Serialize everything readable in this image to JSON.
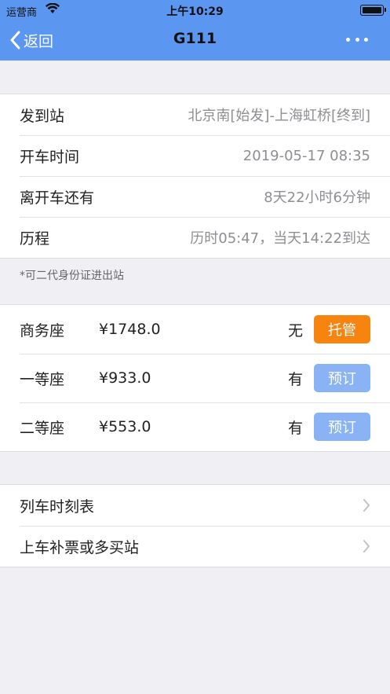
{
  "status_bar": {
    "carrier": "运营商",
    "time": "上午10:29"
  },
  "nav": {
    "back_label": "返回",
    "title": "G111"
  },
  "trip_info": [
    {
      "label": "发到站",
      "value": "北京南[始发]-上海虹桥[终到]"
    },
    {
      "label": "开车时间",
      "value": "2019-05-17 08:35"
    },
    {
      "label": "离开车还有",
      "value": "8天22小时6分钟"
    },
    {
      "label": "历程",
      "value": "历时05:47，当天14:22到达"
    }
  ],
  "note": "*可二代身份证进出站",
  "seats": [
    {
      "name": "商务座",
      "price": "¥1748.0",
      "availability": "无",
      "action": "托管",
      "action_color": "#f88410"
    },
    {
      "name": "一等座",
      "price": "¥933.0",
      "availability": "有",
      "action": "预订",
      "action_color": "#8ab3f6"
    },
    {
      "name": "二等座",
      "price": "¥553.0",
      "availability": "有",
      "action": "预订",
      "action_color": "#8ab3f6"
    }
  ],
  "links": [
    {
      "label": "列车时刻表"
    },
    {
      "label": "上车补票或多买站"
    }
  ],
  "colors": {
    "nav_bg": "#5b97f0",
    "page_bg": "#efeff4",
    "accent_orange": "#f88410",
    "accent_blue": "#8ab3f6"
  }
}
